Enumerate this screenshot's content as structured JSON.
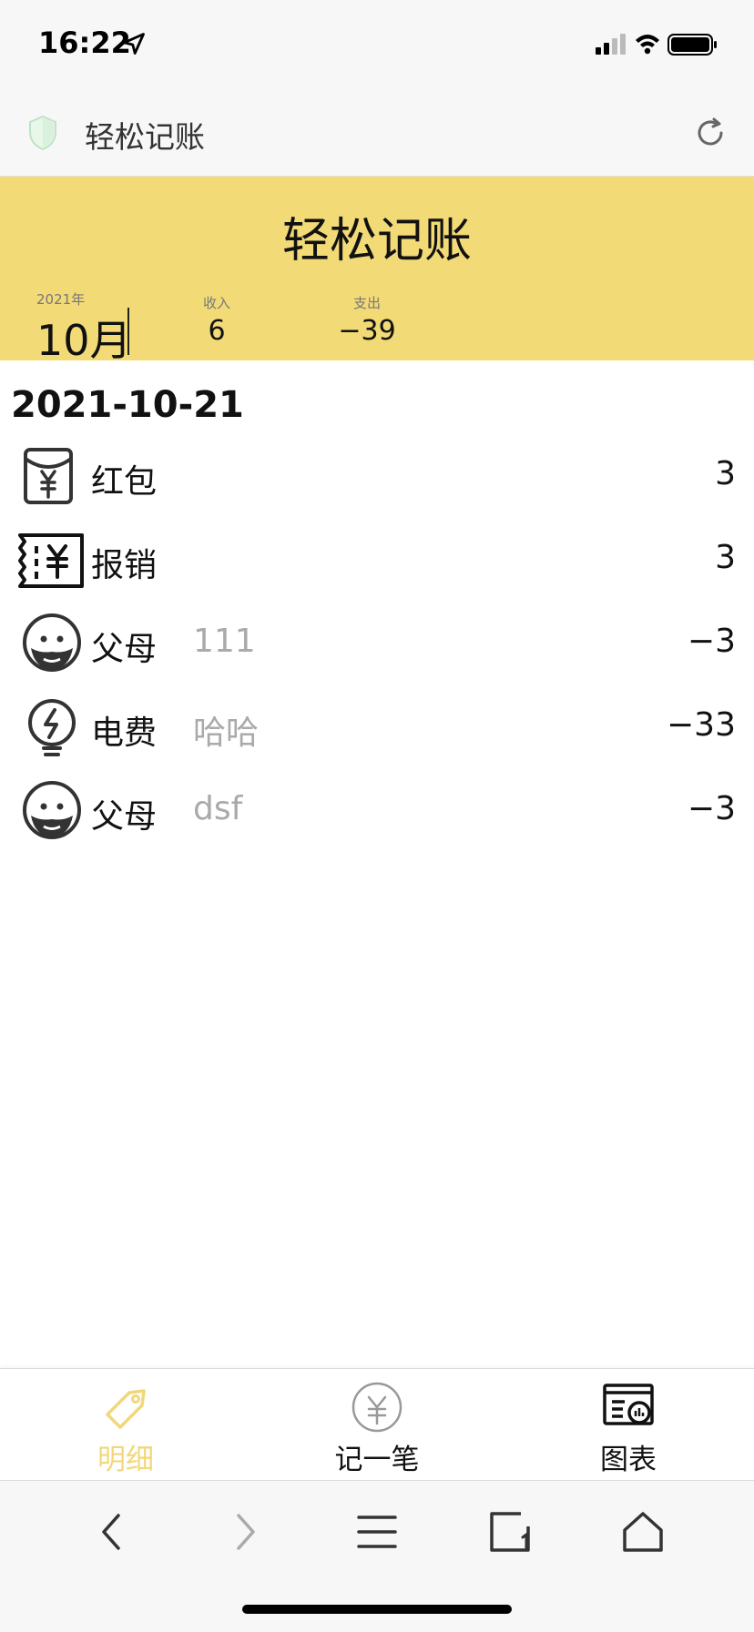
{
  "status_bar": {
    "time": "16:22"
  },
  "browser": {
    "title": "轻松记账"
  },
  "header": {
    "title": "轻松记账",
    "year": "2021年",
    "month": "10月",
    "income_label": "收入",
    "income_value": "6",
    "expense_label": "支出",
    "expense_value": "−39"
  },
  "day": {
    "date": "2021-10-21",
    "entries": [
      {
        "icon": "red-envelope-icon",
        "category": "红包",
        "note": "",
        "amount": "3"
      },
      {
        "icon": "reimburse-ticket-icon",
        "category": "报销",
        "note": "",
        "amount": "3"
      },
      {
        "icon": "parents-icon",
        "category": "父母",
        "note": "111",
        "amount": "−3"
      },
      {
        "icon": "electricity-bulb-icon",
        "category": "电费",
        "note": "哈哈",
        "amount": "−33"
      },
      {
        "icon": "parents-icon",
        "category": "父母",
        "note": "dsf",
        "amount": "−3"
      }
    ]
  },
  "tabs": [
    {
      "label": "明细",
      "icon": "tag-icon",
      "active": true
    },
    {
      "label": "记一笔",
      "icon": "yuan-circle-icon",
      "active": false
    },
    {
      "label": "图表",
      "icon": "chart-report-icon",
      "active": false
    }
  ],
  "colors": {
    "header_bg": "#f2da76",
    "active_tab": "#f2d77a"
  }
}
